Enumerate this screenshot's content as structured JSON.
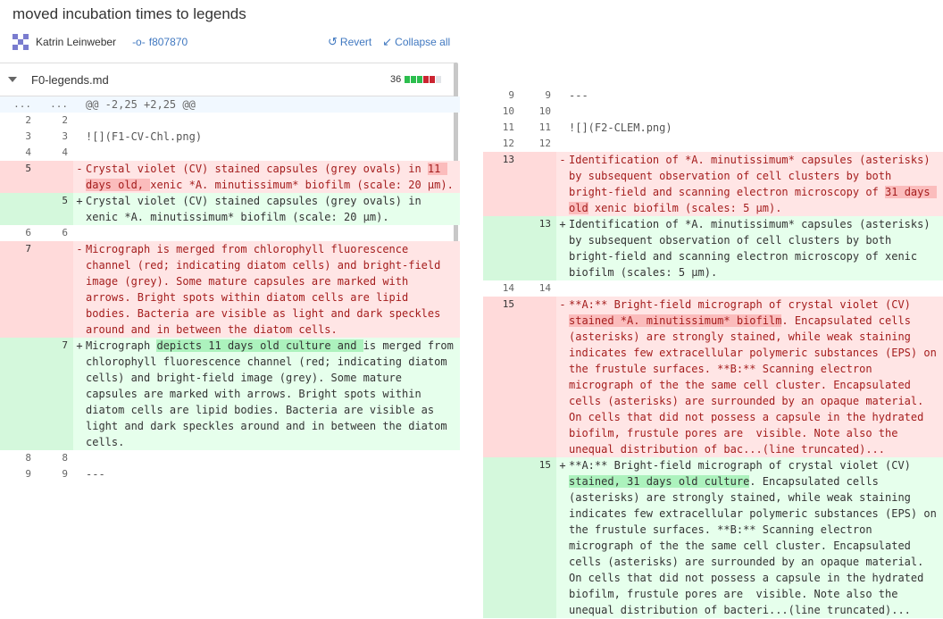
{
  "commit": {
    "title": "moved incubation times to legends",
    "author": "Katrin Leinweber",
    "hash": "f807870",
    "revert_label": "Revert",
    "collapse_label": "Collapse all"
  },
  "file": {
    "name": "F0-legends.md",
    "changes": "36",
    "bar_colors": [
      "#2cbe4e",
      "#2cbe4e",
      "#2cbe4e",
      "#cb2431",
      "#cb2431",
      "#e1e4e8"
    ]
  },
  "left_diff": {
    "rows": [
      {
        "type": "hunk",
        "old": "...",
        "new": "...",
        "mark": "",
        "segments": [
          {
            "t": "@@ -2,25 +2,25 @@"
          }
        ]
      },
      {
        "type": "ctx",
        "old": "2",
        "new": "2",
        "mark": "",
        "segments": [
          {
            "t": ""
          }
        ]
      },
      {
        "type": "ctx",
        "old": "3",
        "new": "3",
        "mark": "",
        "segments": [
          {
            "t": "![](F1-CV-Chl.png)"
          }
        ]
      },
      {
        "type": "ctx",
        "old": "4",
        "new": "4",
        "mark": "",
        "segments": [
          {
            "t": ""
          }
        ]
      },
      {
        "type": "del",
        "old": "5",
        "new": "",
        "mark": "-",
        "segments": [
          {
            "t": "Crystal violet (CV) stained capsules (grey ovals) in "
          },
          {
            "t": "11 days old, ",
            "hl": true
          },
          {
            "t": "xenic *A. minutissimum* biofilm (scale: 20 µm)."
          }
        ]
      },
      {
        "type": "add",
        "old": "",
        "new": "5",
        "mark": "+",
        "segments": [
          {
            "t": "Crystal violet (CV) stained capsules (grey ovals) in xenic *A. minutissimum* biofilm (scale: 20 µm)."
          }
        ]
      },
      {
        "type": "ctx",
        "old": "6",
        "new": "6",
        "mark": "",
        "segments": [
          {
            "t": ""
          }
        ]
      },
      {
        "type": "del",
        "old": "7",
        "new": "",
        "mark": "-",
        "segments": [
          {
            "t": "Micrograph is merged from chlorophyll fluorescence channel (red; indicating diatom cells) and bright-field image (grey). Some mature capsules are marked with arrows. Bright spots within diatom cells are lipid bodies. Bacteria are visible as light and dark speckles around and in between the diatom cells."
          }
        ]
      },
      {
        "type": "add",
        "old": "",
        "new": "7",
        "mark": "+",
        "segments": [
          {
            "t": "Micrograph "
          },
          {
            "t": "depicts 11 days old culture and ",
            "hl": true
          },
          {
            "t": "is merged from chlorophyll fluorescence channel (red; indicating diatom cells) and bright-field image (grey). Some mature capsules are marked with arrows. Bright spots within diatom cells are lipid bodies. Bacteria are visible as light and dark speckles around and in between the diatom cells."
          }
        ]
      },
      {
        "type": "ctx",
        "old": "8",
        "new": "8",
        "mark": "",
        "segments": [
          {
            "t": ""
          }
        ]
      },
      {
        "type": "ctx",
        "old": "9",
        "new": "9",
        "mark": "",
        "segments": [
          {
            "t": "---"
          }
        ]
      }
    ]
  },
  "right_diff": {
    "rows": [
      {
        "type": "ctx",
        "old": "9",
        "new": "9",
        "mark": "",
        "segments": [
          {
            "t": "---"
          }
        ]
      },
      {
        "type": "ctx",
        "old": "10",
        "new": "10",
        "mark": "",
        "segments": [
          {
            "t": ""
          }
        ]
      },
      {
        "type": "ctx",
        "old": "11",
        "new": "11",
        "mark": "",
        "segments": [
          {
            "t": "![](F2-CLEM.png)"
          }
        ]
      },
      {
        "type": "ctx",
        "old": "12",
        "new": "12",
        "mark": "",
        "segments": [
          {
            "t": ""
          }
        ]
      },
      {
        "type": "del",
        "old": "13",
        "new": "",
        "mark": "-",
        "segments": [
          {
            "t": "Identification of *A. minutissimum* capsules (asterisks) by subsequent observation of cell clusters by both bright-field and scanning electron microscopy of "
          },
          {
            "t": "31 days old",
            "hl": true
          },
          {
            "t": " xenic biofilm (scales: 5 µm)."
          }
        ]
      },
      {
        "type": "add",
        "old": "",
        "new": "13",
        "mark": "+",
        "segments": [
          {
            "t": "Identification of *A. minutissimum* capsules (asterisks) by subsequent observation of cell clusters by both bright-field and scanning electron microscopy of xenic biofilm (scales: 5 µm)."
          }
        ]
      },
      {
        "type": "ctx",
        "old": "14",
        "new": "14",
        "mark": "",
        "segments": [
          {
            "t": ""
          }
        ]
      },
      {
        "type": "del",
        "old": "15",
        "new": "",
        "mark": "-",
        "segments": [
          {
            "t": "**A:** Bright-field micrograph of crystal violet (CV) "
          },
          {
            "t": "stained *A. minutissimum* biofilm",
            "hl": true
          },
          {
            "t": ". Encapsulated cells (asterisks) are strongly stained, while weak staining indicates few extracellular polymeric substances (EPS) on the frustule surfaces. **B:** Scanning electron micrograph of the the same cell cluster. Encapsulated cells (asterisks) are surrounded by an opaque material. On cells that did not possess a capsule in the hydrated biofilm, frustule pores are  visible. Note also the unequal distribution of bac...(line truncated)..."
          }
        ]
      },
      {
        "type": "add",
        "old": "",
        "new": "15",
        "mark": "+",
        "segments": [
          {
            "t": "**A:** Bright-field micrograph of crystal violet (CV) "
          },
          {
            "t": "stained, 31 days old culture",
            "hl": true
          },
          {
            "t": ". Encapsulated cells (asterisks) are strongly stained, while weak staining indicates few extracellular polymeric substances (EPS) on the frustule surfaces. **B:** Scanning electron micrograph of the the same cell cluster. Encapsulated cells (asterisks) are surrounded by an opaque material. On cells that did not possess a capsule in the hydrated biofilm, frustule pores are  visible. Note also the unequal distribution of bacteri...(line truncated)..."
          }
        ]
      }
    ]
  }
}
